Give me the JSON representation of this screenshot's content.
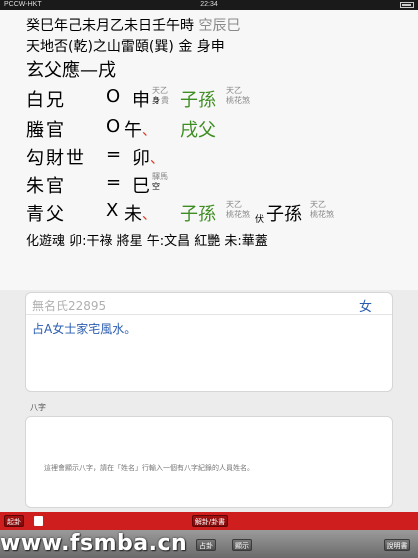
{
  "status_bar": {
    "carrier": "PCCW-HKT",
    "wifi_icon": "wifi-icon",
    "time": "22:34",
    "battery_icon": "battery-icon"
  },
  "header": {
    "date_line": "癸巳年己未月乙未日壬午時",
    "kong_wang": "空辰巳",
    "gua_name": "天地否(乾)之山雷頤(巽)",
    "element": "金",
    "shen": "身申"
  },
  "lines": [
    {
      "relative": "玄",
      "liuqin": "父",
      "yao": "應",
      "mark": "—",
      "ganzhi": "戌"
    },
    {
      "relative": "白",
      "liuqin": "兄",
      "mark": "O",
      "ganzhi": "申",
      "sub": "身",
      "note1": "天乙",
      "note1b": "貴",
      "changed": "子孫",
      "note2": "天乙",
      "note2b": "桃花煞"
    },
    {
      "relative": "螣",
      "liuqin": "官",
      "mark": "O",
      "ganzhi": "午",
      "dot": "、",
      "changed": "戌父"
    },
    {
      "relative": "勾",
      "liuqin": "財",
      "yao": "世",
      "mark": "=",
      "ganzhi": "卯",
      "dot": "、"
    },
    {
      "relative": "朱",
      "liuqin": "官",
      "mark": "=",
      "ganzhi": "巳",
      "note1": "驛馬",
      "note1b": "空"
    },
    {
      "relative": "青",
      "liuqin": "父",
      "mark": "X",
      "ganzhi": "未",
      "dot": "、",
      "changed": "子孫",
      "note2": "天乙",
      "note2b": "桃花煞",
      "fu": "伏",
      "fu_liuqin": "子孫",
      "note3": "天乙",
      "note3b": "桃花煞"
    }
  ],
  "footer_line": "化遊魂 卯:干祿 將星 午:文昌 紅艷 未:華蓋",
  "form": {
    "name_placeholder": "無名氏22895",
    "gender": "女",
    "question": "占A女士家宅風水。",
    "bazi_label": "八字",
    "bazi_hint": "這裡會顯示八字，請在「姓名」行輸入一個有八字紀錄的人員姓名。"
  },
  "toolbar": {
    "left_btn": "起卦",
    "book_icon": "book-icon",
    "center_btn": "解卦/卦書",
    "row2": [
      "",
      "",
      "",
      "占卦",
      "顯示",
      "",
      "說明書"
    ]
  },
  "watermark": "www.fsmba.cn"
}
